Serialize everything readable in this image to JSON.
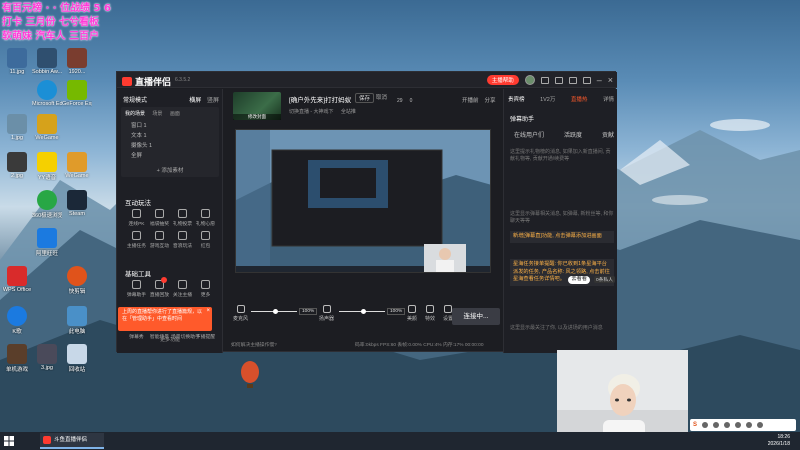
{
  "overlay": {
    "lines": [
      "有百元榜  ·  ·  位战绩 5 6",
      "打卡 三月份 七兮看板",
      "软萌妹 汽车人 三百户"
    ],
    "color": "#ff3ad8"
  },
  "desktop_icons": [
    {
      "label": "11.jpg",
      "icon": "image-icon",
      "color": "#3d6b9c"
    },
    {
      "label": "Sobbin Aw...",
      "icon": "image-icon",
      "color": "#2f4f6f"
    },
    {
      "label": "1920...",
      "icon": "image-icon",
      "color": "#7a3d2f"
    },
    {
      "label": "Microsoft Edge",
      "icon": "edge-icon",
      "color": "#1b8fd6"
    },
    {
      "label": "GeForce Expe...",
      "icon": "nvidia-icon",
      "color": "#76b900"
    },
    {
      "label": "1.jpg",
      "icon": "image-icon",
      "color": "#6b8fa8"
    },
    {
      "label": "WeGame",
      "icon": "wegame-icon",
      "color": "#d6a21b"
    },
    {
      "label": "2.jpg",
      "icon": "image-icon",
      "color": "#3a3a3a"
    },
    {
      "label": "YY语音",
      "icon": "yy-icon",
      "color": "#f5d000"
    },
    {
      "label": "WeGame",
      "icon": "wegame-icon",
      "color": "#e09b2a"
    },
    {
      "label": "Steam",
      "icon": "steam-icon",
      "color": "#1b2838"
    },
    {
      "label": "360极速浏览器",
      "icon": "browser-icon",
      "color": "#28a745"
    },
    {
      "label": "阿里旺旺",
      "icon": "shield-icon",
      "color": "#1b7ae0"
    },
    {
      "label": "WPS Office",
      "icon": "wps-icon",
      "color": "#d92b2b"
    },
    {
      "label": "快剪辑",
      "icon": "clip-icon",
      "color": "#e0531b"
    },
    {
      "label": "K歌",
      "icon": "k-icon",
      "color": "#1b7ae0"
    },
    {
      "label": "此电脑",
      "icon": "pc-icon",
      "color": "#4a90c8"
    },
    {
      "label": "单机游戏",
      "icon": "game-icon",
      "color": "#5a3e2a"
    },
    {
      "label": "3.jpg",
      "icon": "image-icon",
      "color": "#4a4a5a"
    },
    {
      "label": "回收站",
      "icon": "recycle-bin-icon",
      "color": "#c8d8e8"
    }
  ],
  "app": {
    "name": "直播伴侣",
    "version": "6.3.5.2",
    "feedback_label": "主播帮助",
    "left": {
      "mode": "常规模式",
      "mode_tabs": [
        "横屏",
        "竖屏"
      ],
      "scene_tabs": [
        "我的场景",
        "场景",
        "画面"
      ],
      "scene_items": [
        "窗口 1",
        "文本 1",
        "摄像头 1",
        "全屏"
      ],
      "add_source": "+ 添加素材",
      "interact_title": "互动玩法",
      "interact_items": [
        "连线PK",
        "福袋抽奖",
        "礼物投票",
        "礼物心愿",
        "主播任务",
        "游戏互动",
        "音浪玩法",
        "红包"
      ],
      "tools_title": "基础工具",
      "tools_items": [
        "弹幕助手",
        "直播回放",
        "关注主播",
        "更多"
      ],
      "tools_items2": [
        "弹幕秀",
        "智能场景",
        "场景切换助手",
        "下播提醒"
      ],
      "tooltip": "上周的直播帮你进行了直播篇规，以在「管理助手」中查看时间",
      "more_tools": "更多功能"
    },
    "header": {
      "thumb_label": "修改封面",
      "room_title": "[确户外先来]打打蚂蚁",
      "save": "保存",
      "cancel": "取消",
      "category": "切换直播 - 大神戏下",
      "network": "全站推",
      "metrics": [
        "29",
        "0"
      ],
      "actions": [
        "开播前",
        "分享",
        "更多"
      ]
    },
    "controls": {
      "mic_label": "麦克风",
      "mic_pct": "100%",
      "speaker_label": "扬声器",
      "speaker_pct": "100%",
      "beauty": "美颜",
      "effect": "特效",
      "settings": "设置",
      "go_live": "连接中..."
    },
    "status": {
      "left": "如何解决主播操作慢?",
      "right": "码率:0kbps  FPS:60  丢帧:0.00%  CPU:4%  内存:17%  00:00:00"
    },
    "right": {
      "tabs": [
        "贵宾榜",
        "观众榜",
        "1V2万",
        "直播热",
        "详情"
      ],
      "panel_title": "弹幕助手",
      "sub_tabs": [
        "在线用户们",
        "活跃度",
        "贡献"
      ],
      "notice1": "这里提示礼物榜的消息, 如果加入新直播间, 贡献礼物等, 贡献开通/续费等",
      "notice2": "这里显示弹幕相关消息, 如弹幕, 新粉丝等, 和你聊天等等",
      "card1": "新增[弹幕直]功能, 点击弹幕添加进画面",
      "card2": "星海任务接单提醒: 你已收到1条星海平台派发的任务, 产品名称: 风之领路, 点击前往星海查看任务详情吧。",
      "card2_pill": "去看看",
      "tag": "0条私人",
      "footer": "这里显示最关注了你, 以及进场的用户消息"
    }
  },
  "clock": {
    "time": "18:26",
    "date": "2026/1/18"
  },
  "taskbar": {
    "app_label": "斗鱼直播伴侣"
  }
}
